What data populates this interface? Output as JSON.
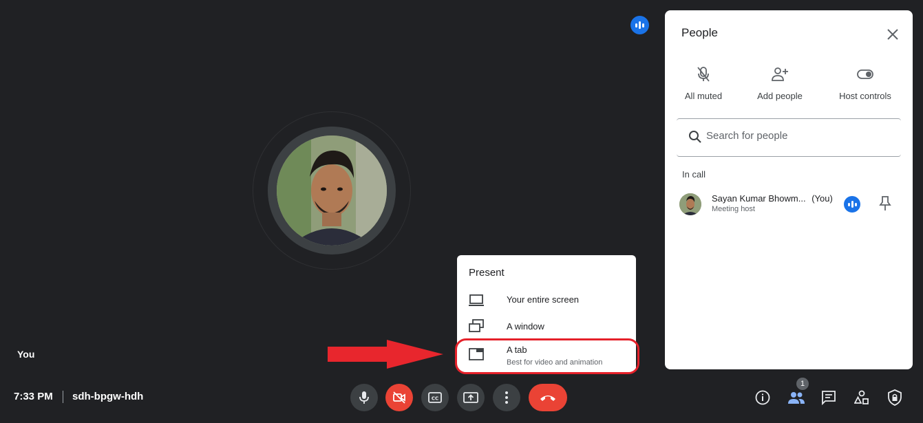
{
  "stage": {
    "you_label": "You"
  },
  "meeting": {
    "time": "7:33 PM",
    "code": "sdh-bpgw-hdh"
  },
  "controls": {
    "left": [
      "mic-icon",
      "camera-off-icon",
      "captions-icon",
      "present-icon",
      "more-vert-icon"
    ],
    "right": [
      "info-icon",
      "people-icon",
      "chat-icon",
      "activities-icon",
      "host-controls-icon"
    ],
    "people_count": "1",
    "accent_red": "#ea4335"
  },
  "present_menu": {
    "title": "Present",
    "items": [
      {
        "label": "Your entire screen",
        "icon": "monitor-icon"
      },
      {
        "label": "A window",
        "icon": "window-icon"
      },
      {
        "label": "A tab",
        "sub": "Best for video and animation",
        "icon": "tab-icon"
      }
    ],
    "highlight_color": "#e5212a"
  },
  "people_panel": {
    "title": "People",
    "actions": [
      {
        "label": "All muted",
        "icon": "mic-off-icon"
      },
      {
        "label": "Add people",
        "icon": "person-add-icon"
      },
      {
        "label": "Host controls",
        "icon": "toggle-icon"
      }
    ],
    "search_placeholder": "Search for people",
    "section_label": "In call",
    "participant": {
      "name": "Sayan Kumar Bhowm...",
      "you": "(You)",
      "role": "Meeting host"
    }
  },
  "colors": {
    "background": "#202124",
    "speaking_blue": "#1a73e8"
  }
}
